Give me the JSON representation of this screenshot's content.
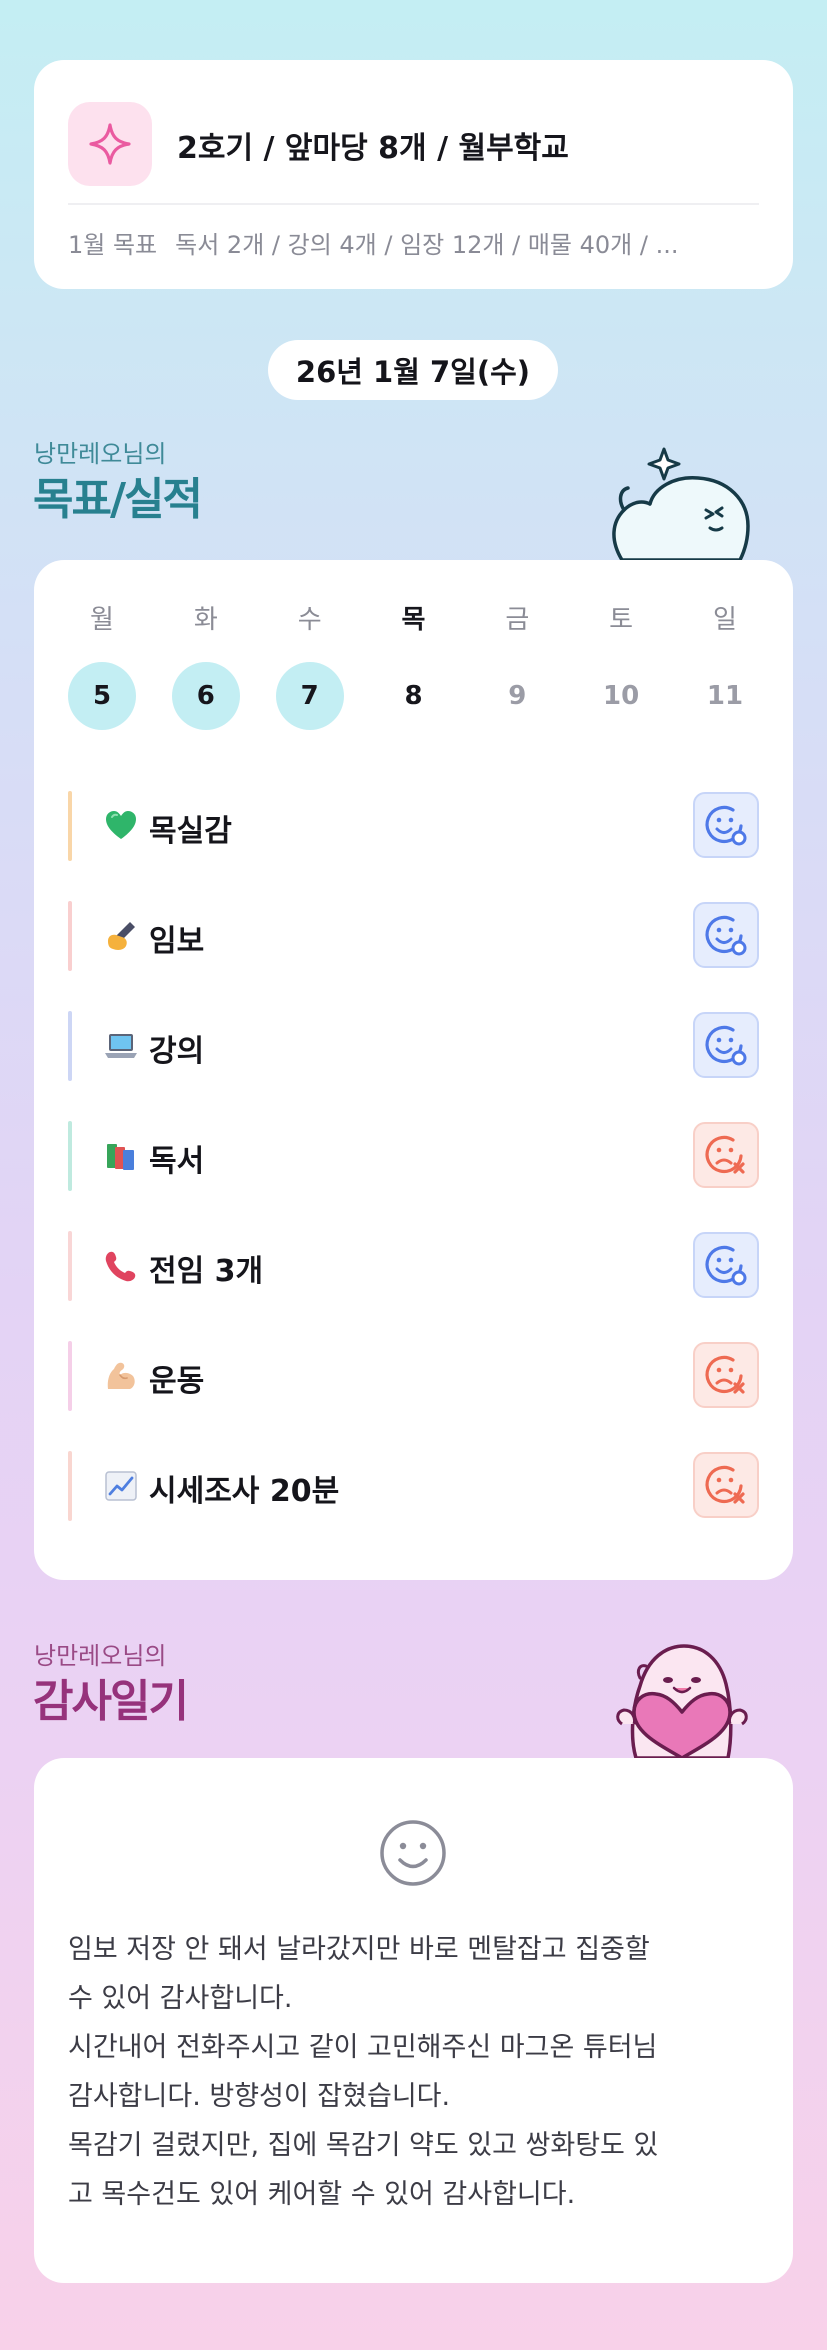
{
  "summary": {
    "title": "2호기 / 앞마당 8개 / 월부학교",
    "goal_label": "1월 목표",
    "goal_text": "독서 2개 / 강의 4개 / 임장 12개 / 매물 40개 / ..."
  },
  "date": "26년 1월 7일(수)",
  "goal_section": {
    "subtitle": "낭만레오님의",
    "title": "목표/실적"
  },
  "week": [
    {
      "day": "월",
      "date": "5",
      "state": "done"
    },
    {
      "day": "화",
      "date": "6",
      "state": "done"
    },
    {
      "day": "수",
      "date": "7",
      "state": "done"
    },
    {
      "day": "목",
      "date": "8",
      "state": "today"
    },
    {
      "day": "금",
      "date": "9",
      "state": "future"
    },
    {
      "day": "토",
      "date": "10",
      "state": "future"
    },
    {
      "day": "일",
      "date": "11",
      "state": "future"
    }
  ],
  "goals": [
    {
      "emoji": "green-heart-icon",
      "label": "목실감",
      "status": "achieved",
      "bar_color": "#f9d6a8"
    },
    {
      "emoji": "writing-hand-icon",
      "label": "임보",
      "status": "achieved",
      "bar_color": "#f9cfcf"
    },
    {
      "emoji": "laptop-icon",
      "label": "강의",
      "status": "achieved",
      "bar_color": "#cdd6f5"
    },
    {
      "emoji": "books-icon",
      "label": "독서",
      "status": "missed",
      "bar_color": "#bfeadf"
    },
    {
      "emoji": "phone-icon",
      "label": "전임 3개",
      "status": "achieved",
      "bar_color": "#f9d6d6"
    },
    {
      "emoji": "flexed-arm-icon",
      "label": "운동",
      "status": "missed",
      "bar_color": "#f5cfe8"
    },
    {
      "emoji": "chart-increasing-icon",
      "label": "시세조사 20분",
      "status": "missed",
      "bar_color": "#f9d6d0"
    }
  ],
  "gratitude_section": {
    "subtitle": "낭만레오님의",
    "title": "감사일기"
  },
  "gratitude": {
    "icon": "smile-icon",
    "lines": [
      "임보 저장 안 돼서 날라갔지만 바로 멘탈잡고 집중할",
      "수 있어 감사합니다.",
      "시간내어 전화주시고 같이 고민해주신 마그온 튜터님",
      "감사합니다. 방향성이 잡혔습니다.",
      "목감기 걸렸지만, 집에 목감기 약도 있고 쌍화탕도 있",
      "고 목수건도 있어 케어할 수 있어 감사합니다."
    ]
  },
  "colors": {
    "teal_title": "#27808f",
    "plum_title": "#96327b",
    "done_circle": "#c3eef3",
    "achieved_blue": "#4e79e8",
    "missed_red": "#ee6a52"
  }
}
